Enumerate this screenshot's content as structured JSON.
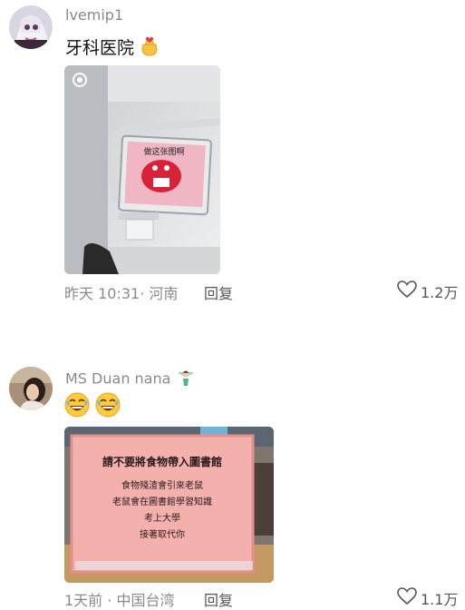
{
  "comments": [
    {
      "username": "lvemip1",
      "text": "牙科医院",
      "emoji": "lucky-bag",
      "meta": "昨天 10:31· 河南",
      "reply": "回复",
      "likes": "1.2万",
      "photo": {
        "scene": "dental-chair-monitor",
        "screen_text": "做这张图啊"
      }
    },
    {
      "username": "MS Duan nana",
      "username_badge": "fairy",
      "emojis": [
        "laugh-sweat",
        "laugh-sweat"
      ],
      "meta": "1天前 · 中国台湾",
      "reply": "回复",
      "likes": "1.1万",
      "photo": {
        "scene": "library-sign",
        "sign_title": "請不要將食物帶入圖書館",
        "sign_lines": [
          "食物殘渣會引來老鼠",
          "老鼠會在圖書館學習知識",
          "考上大學",
          "接著取代你"
        ]
      }
    }
  ],
  "colors": {
    "meta": "#8a8a8a",
    "sign_pink": "#f2a7a7",
    "background": "#ffffff"
  }
}
